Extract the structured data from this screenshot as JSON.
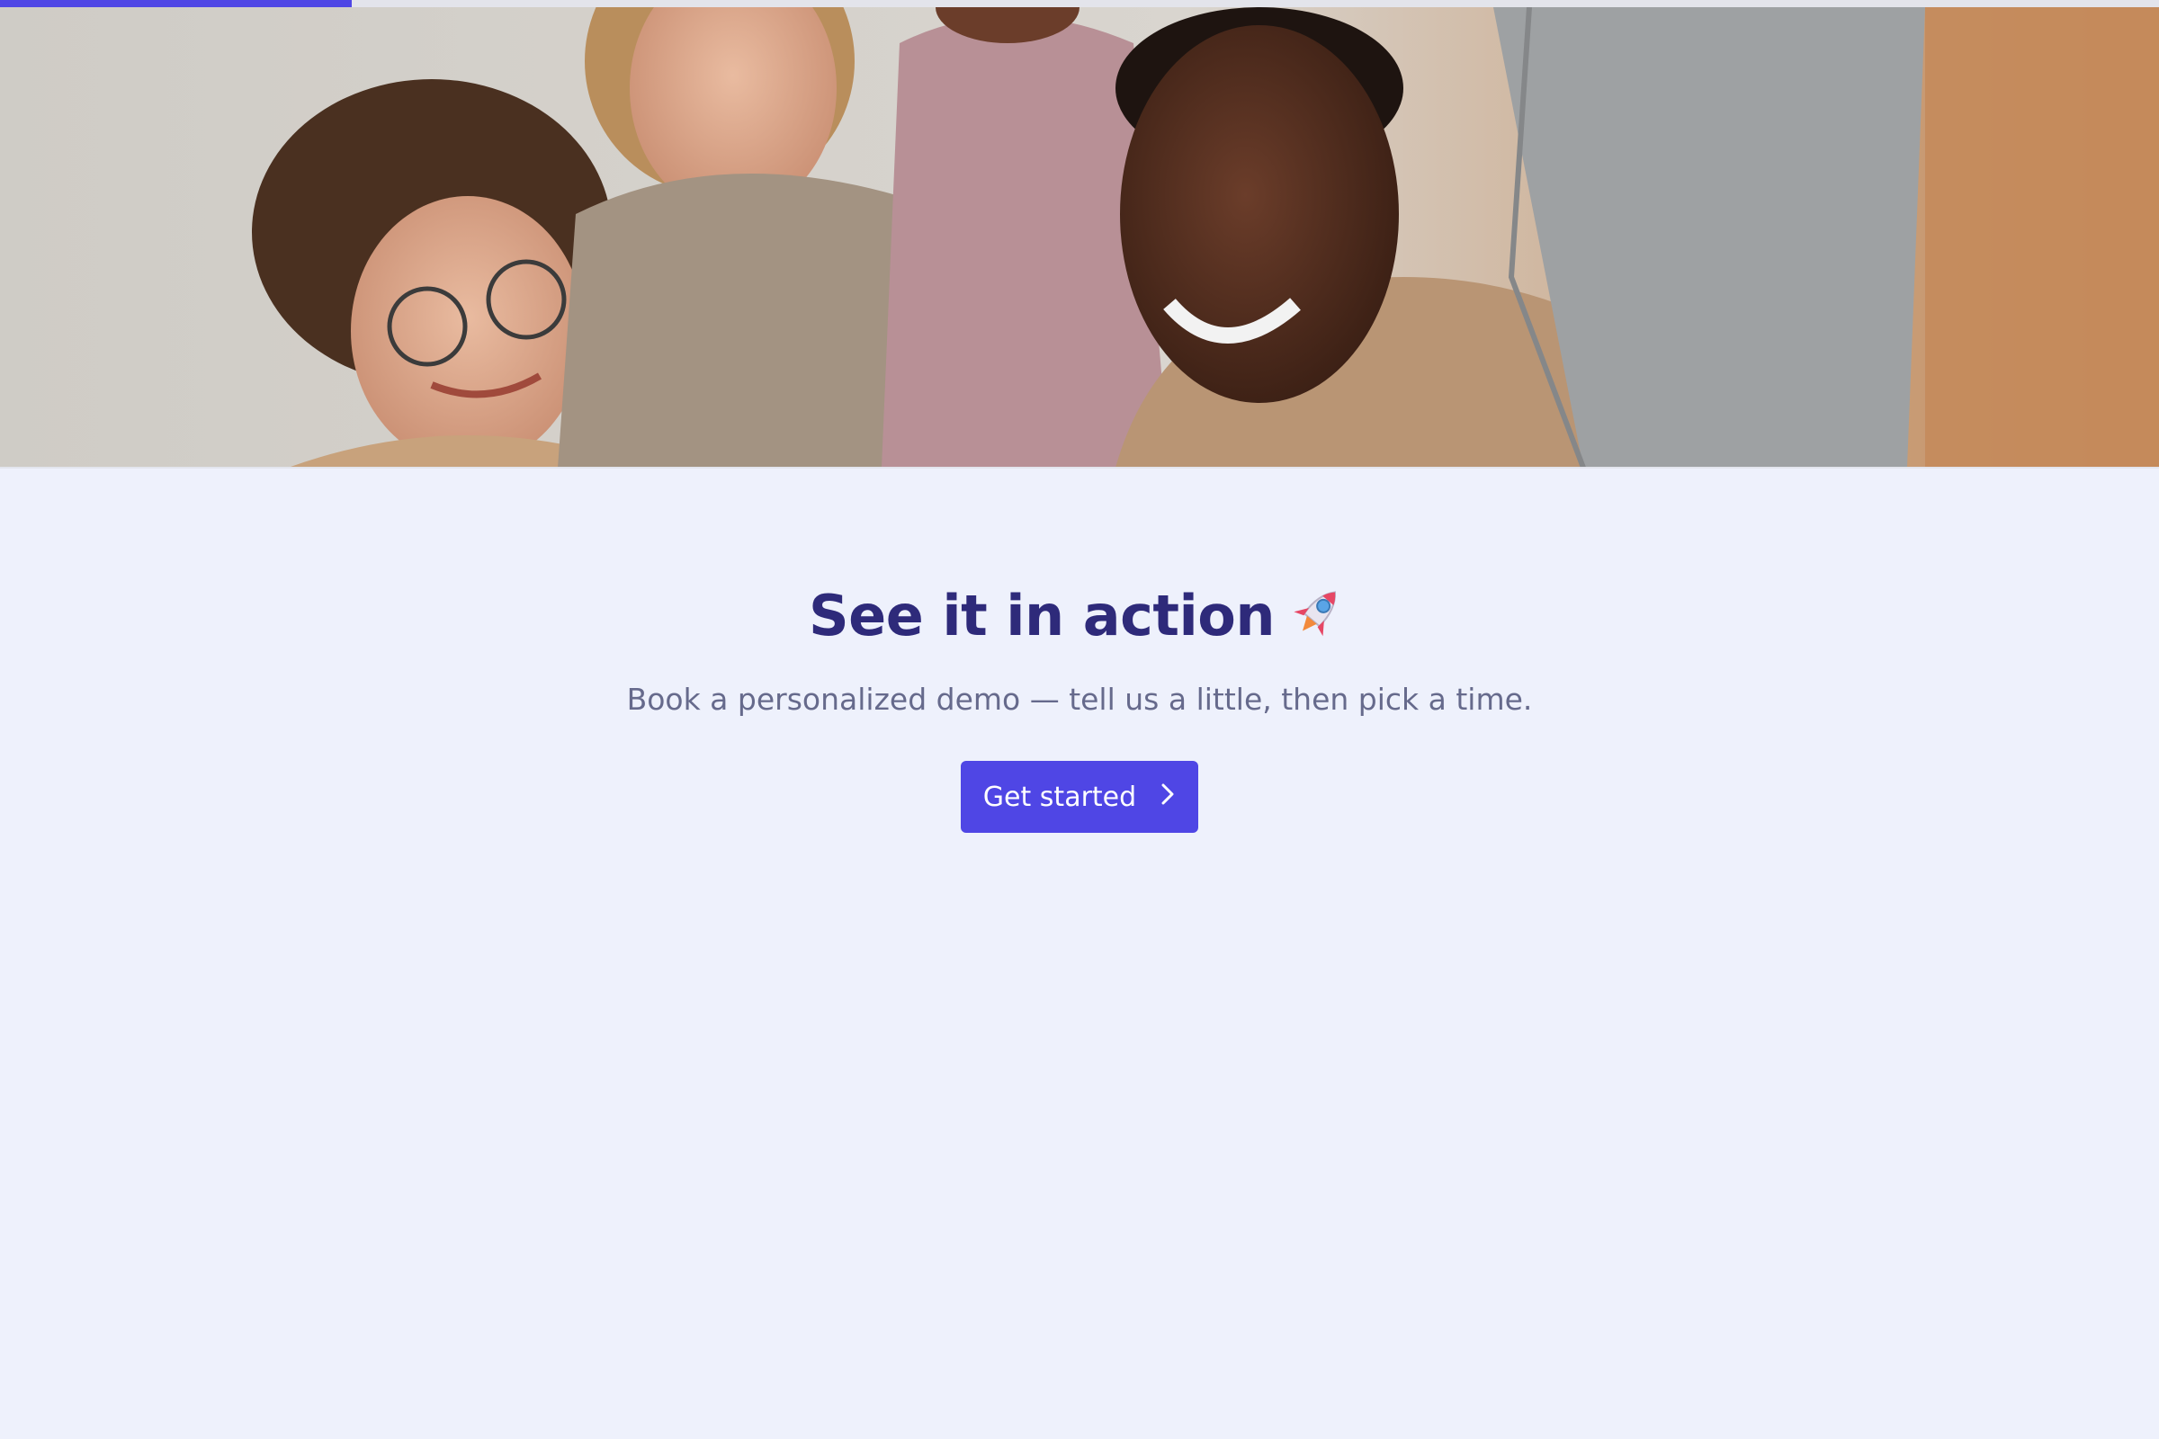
{
  "progress": {
    "value_percent": 16.3,
    "color": "#4F46E5",
    "track_color": "#E3E4EB"
  },
  "hero": {
    "image_description": "team-photo",
    "icon": "team-photo-image"
  },
  "main": {
    "headline": "See it in action",
    "headline_icon": "rocket-icon",
    "subtitle": "Book a personalized demo — tell us a little, then pick a time.",
    "cta_label": "Get started",
    "cta_icon": "chevron-right-icon"
  },
  "colors": {
    "background": "#EEF1FC",
    "headline": "#2E2A7A",
    "subtitle": "#666A8C",
    "accent": "#4F46E5"
  }
}
